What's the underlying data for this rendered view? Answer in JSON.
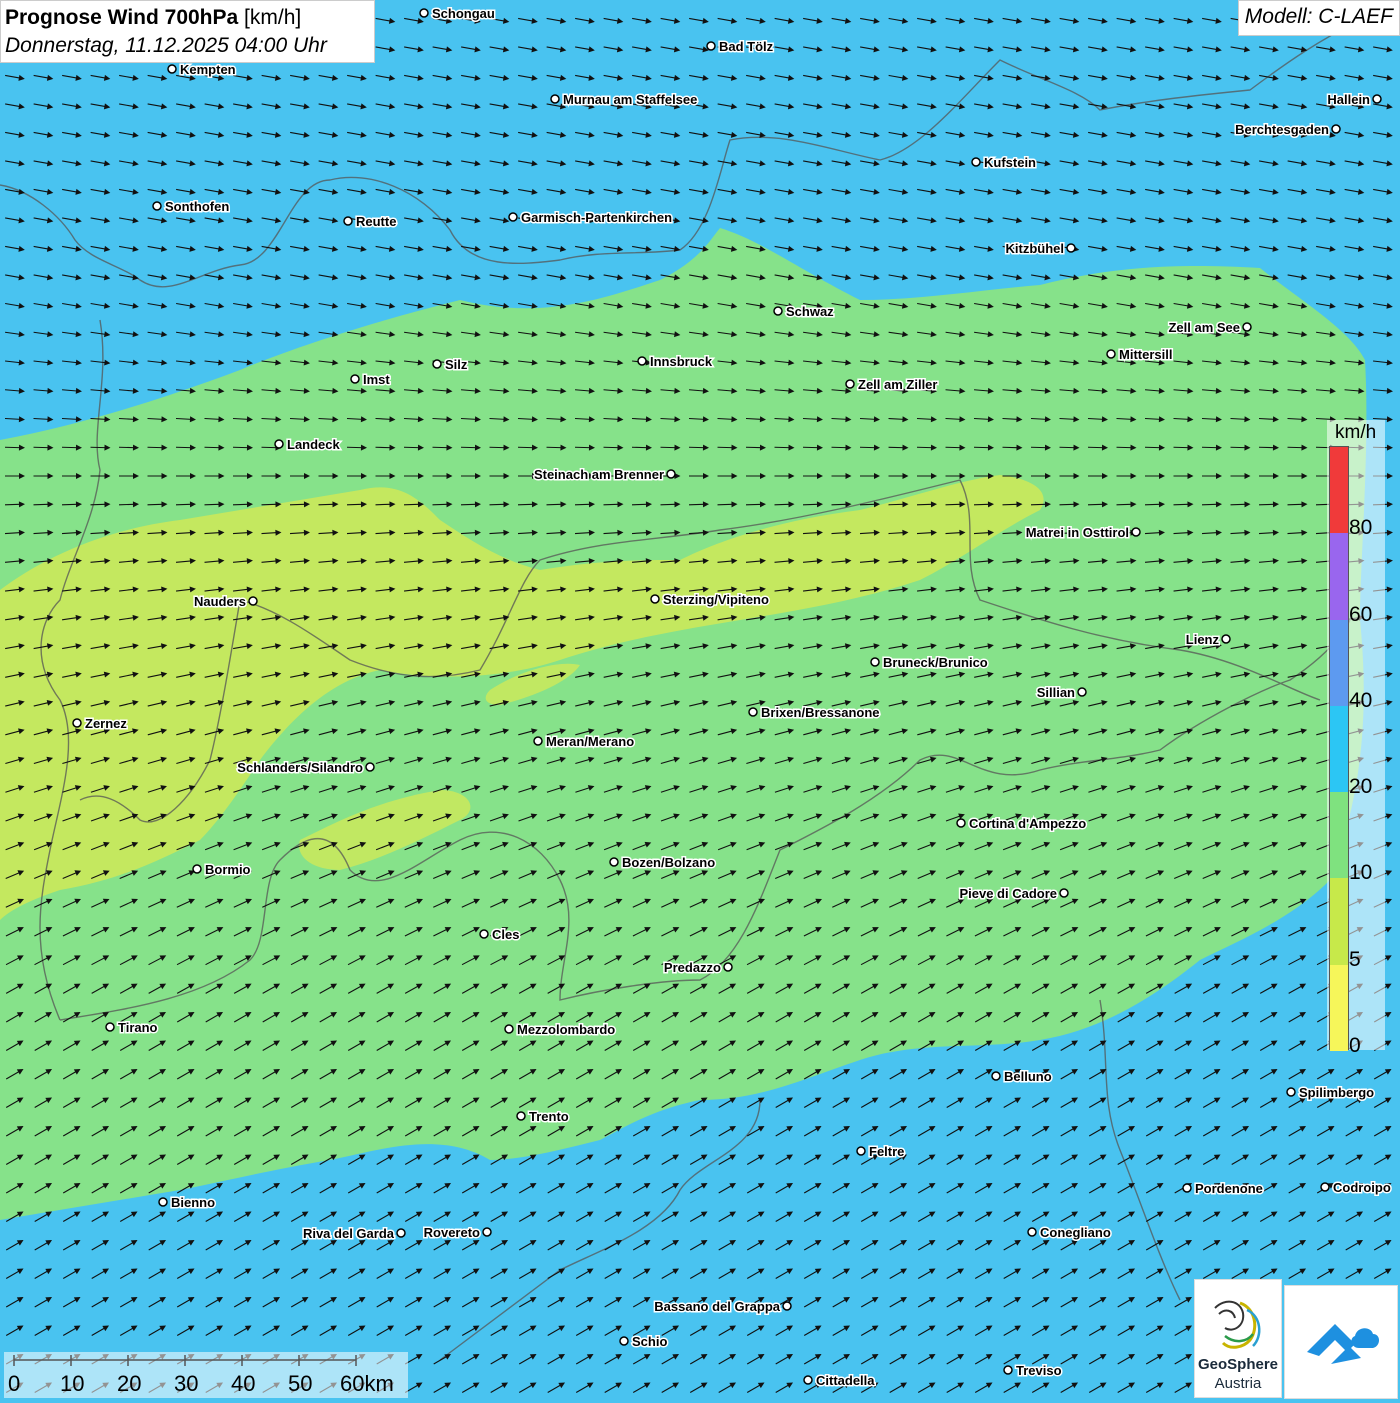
{
  "title": {
    "bold": "Prognose Wind 700hPa",
    "unit": "[km/h]",
    "datetime": "Donnerstag, 11.12.2025 04:00 Uhr"
  },
  "model": "Modell: C-LAEF",
  "legend": {
    "unit": "km/h",
    "labels": [
      "80",
      "60",
      "40",
      "20",
      "10",
      "5",
      "0"
    ],
    "colors": [
      "#f03a3a",
      "#9966ee",
      "#5d9af0",
      "#2cc6f4",
      "#7fe27f",
      "#c7e94a",
      "#f6f65a"
    ]
  },
  "scale": {
    "labels": [
      "0",
      "10",
      "20",
      "30",
      "40",
      "50",
      "60km"
    ]
  },
  "logos": {
    "geosphere_line1": "GeoSphere",
    "geosphere_line2": "Austria",
    "mountain_icon": "mountain-cloud-icon"
  },
  "wind": {
    "direction_deg_north_band": 100,
    "direction_deg_south_band": 60
  },
  "cities": [
    {
      "name": "Schongau"
    },
    {
      "name": "Bad Tölz"
    },
    {
      "name": "Kempten"
    },
    {
      "name": "Murnau am Staffelsee"
    },
    {
      "name": "Hallein"
    },
    {
      "name": "Berchtesgaden"
    },
    {
      "name": "Kufstein"
    },
    {
      "name": "Sonthofen"
    },
    {
      "name": "Reutte"
    },
    {
      "name": "Garmisch-Partenkirchen"
    },
    {
      "name": "Kitzbühel"
    },
    {
      "name": "Schwaz"
    },
    {
      "name": "Zell am See"
    },
    {
      "name": "Mittersill"
    },
    {
      "name": "Innsbruck"
    },
    {
      "name": "Silz"
    },
    {
      "name": "Imst"
    },
    {
      "name": "Zell am Ziller"
    },
    {
      "name": "Landeck"
    },
    {
      "name": "Steinach am Brenner"
    },
    {
      "name": "Matrei in Osttirol"
    },
    {
      "name": "Nauders"
    },
    {
      "name": "Sterzing/Vipiteno"
    },
    {
      "name": "Lienz"
    },
    {
      "name": "Bruneck/Brunico"
    },
    {
      "name": "Sillian"
    },
    {
      "name": "Zernez"
    },
    {
      "name": "Brixen/Bressanone"
    },
    {
      "name": "Meran/Merano"
    },
    {
      "name": "Schlanders/Silandro"
    },
    {
      "name": "Cortina d'Ampezzo"
    },
    {
      "name": "Bozen/Bolzano"
    },
    {
      "name": "Bormio"
    },
    {
      "name": "Pieve di Cadore"
    },
    {
      "name": "Cles"
    },
    {
      "name": "Predazzo"
    },
    {
      "name": "Tirano"
    },
    {
      "name": "Mezzolombardo"
    },
    {
      "name": "Belluno"
    },
    {
      "name": "Spilimbergo"
    },
    {
      "name": "Trento"
    },
    {
      "name": "Feltre"
    },
    {
      "name": "Pordenone"
    },
    {
      "name": "Codroipo"
    },
    {
      "name": "Bienno"
    },
    {
      "name": "Riva del Garda"
    },
    {
      "name": "Rovereto"
    },
    {
      "name": "Conegliano"
    },
    {
      "name": "Bassano del Grappa"
    },
    {
      "name": "Schio"
    },
    {
      "name": "Treviso"
    },
    {
      "name": "Cittadella"
    }
  ]
}
